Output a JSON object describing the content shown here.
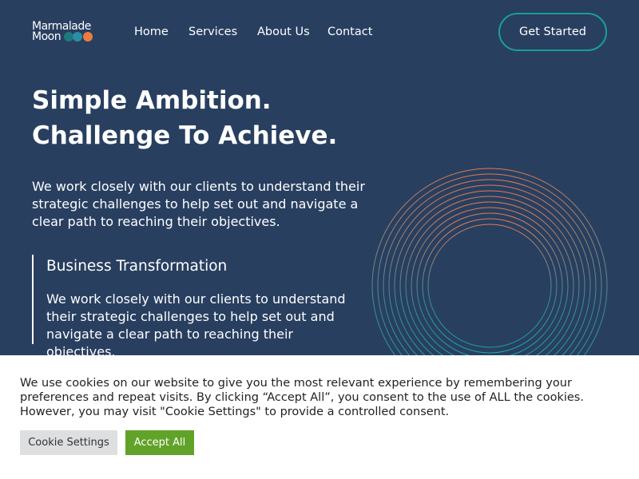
{
  "brand": {
    "logo_line1": "Marmalade",
    "logo_line2": "Moon"
  },
  "nav": {
    "items": [
      {
        "label": "Home"
      },
      {
        "label": "Services"
      },
      {
        "label": "About Us"
      },
      {
        "label": "Contact"
      }
    ],
    "cta_label": "Get Started"
  },
  "hero": {
    "title_line1": "Simple Ambition.",
    "title_line2": "Challenge To Achieve.",
    "description": "We work closely with our clients to understand their strategic challenges to help set out and navigate a clear path to reaching their objectives."
  },
  "feature": {
    "title": "Business Transformation",
    "description": "We work closely with our clients to understand their strategic challenges to help set out and navigate a clear path to reaching their objectives."
  },
  "cookie_banner": {
    "message": "We use cookies on our website to give you the most relevant experience by remembering your preferences and repeat visits. By clicking “Accept All”, you consent to the use of ALL the cookies. However, you may visit \"Cookie Settings\" to provide a controlled consent.",
    "settings_label": "Cookie Settings",
    "accept_label": "Accept All"
  },
  "colors": {
    "background": "#283f60",
    "accent_teal": "#1a9e96",
    "accent_orange": "#ee7b3e",
    "accept_green": "#61a229"
  },
  "icons": {
    "logo_dots": "logo-dots-icon",
    "decorative_rings": "concentric-rings-icon"
  }
}
